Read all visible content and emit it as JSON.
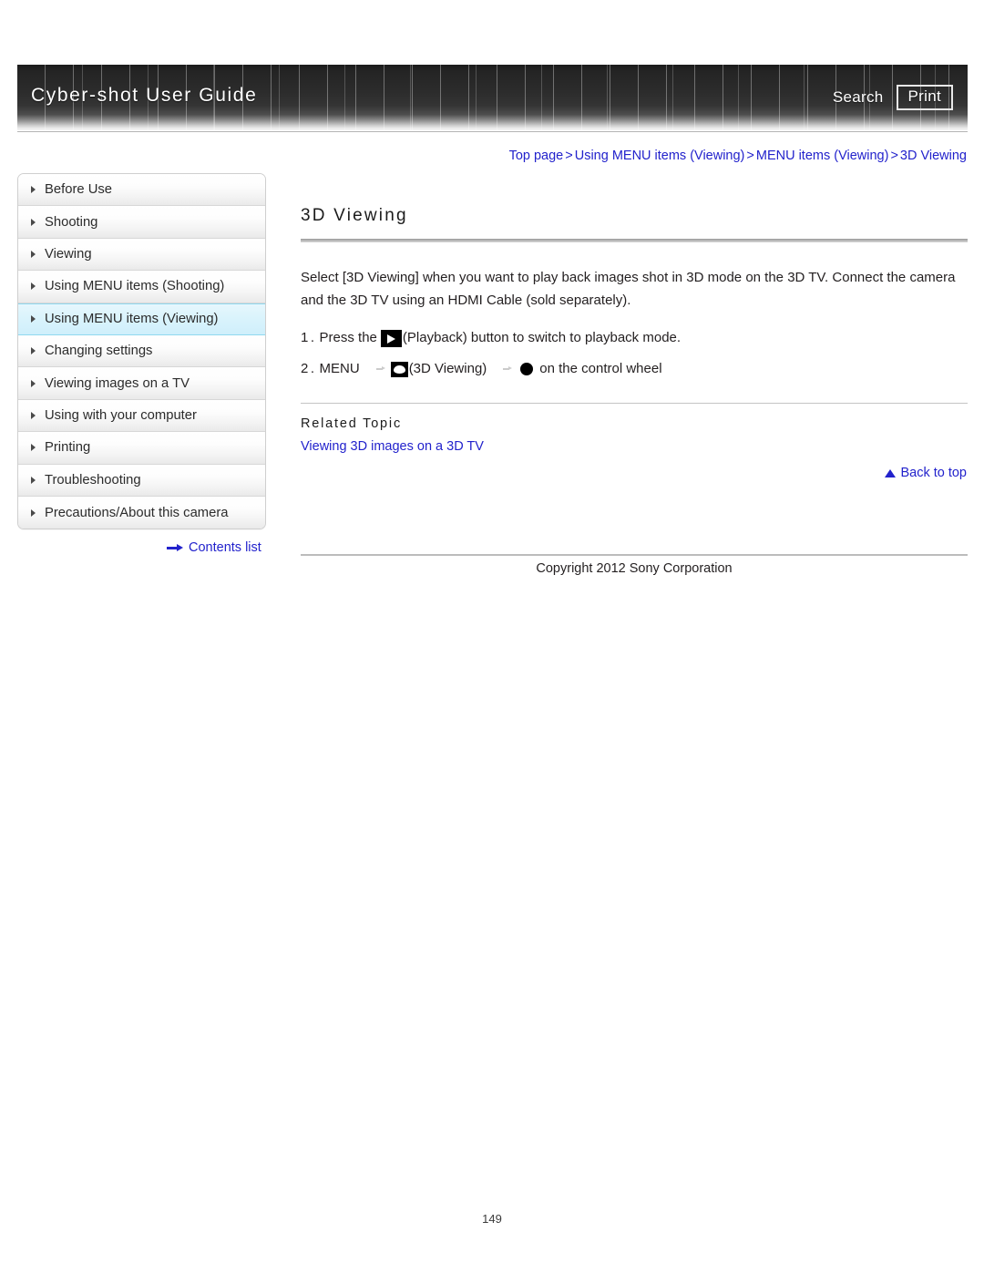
{
  "header": {
    "title": "Cyber-shot User Guide",
    "search_label": "Search",
    "print_label": "Print"
  },
  "breadcrumb": {
    "items": [
      "Top page",
      "Using MENU items (Viewing)",
      "MENU items (Viewing)",
      "3D Viewing"
    ],
    "separator": ">"
  },
  "sidebar": {
    "items": [
      {
        "label": "Before Use",
        "active": false
      },
      {
        "label": "Shooting",
        "active": false
      },
      {
        "label": "Viewing",
        "active": false
      },
      {
        "label": "Using MENU items (Shooting)",
        "active": false
      },
      {
        "label": "Using MENU items (Viewing)",
        "active": true
      },
      {
        "label": "Changing settings",
        "active": false
      },
      {
        "label": "Viewing images on a TV",
        "active": false
      },
      {
        "label": "Using with your computer",
        "active": false
      },
      {
        "label": "Printing",
        "active": false
      },
      {
        "label": "Troubleshooting",
        "active": false
      },
      {
        "label": "Precautions/About this camera",
        "active": false
      }
    ],
    "contents_list_label": "Contents list"
  },
  "main": {
    "title": "3D Viewing",
    "intro": "Select [3D Viewing] when you want to play back images shot in 3D mode on the 3D TV. Connect the camera and the 3D TV using an HDMI Cable (sold separately).",
    "steps": [
      {
        "number": "1.",
        "text_before": "Press the",
        "icon": "playback-icon",
        "text_after": "(Playback) button to switch to playback mode."
      },
      {
        "number": "2.",
        "menu_label": "MENU",
        "icon": "3d-viewing-icon",
        "icon_label": "(3D Viewing)",
        "wheel_icon": "center-button-icon",
        "text_after": "on the control wheel"
      }
    ],
    "related_topic_heading": "Related Topic",
    "related_topic_link": "Viewing 3D images on a 3D TV",
    "back_to_top_label": "Back to top"
  },
  "footer": {
    "copyright": "Copyright 2012 Sony Corporation",
    "page_number": "149"
  },
  "colors": {
    "link": "#2222cc",
    "active_nav_bg": "#d9f3fc",
    "banner_dark": "#2c2c2c",
    "text": "#231f20"
  }
}
